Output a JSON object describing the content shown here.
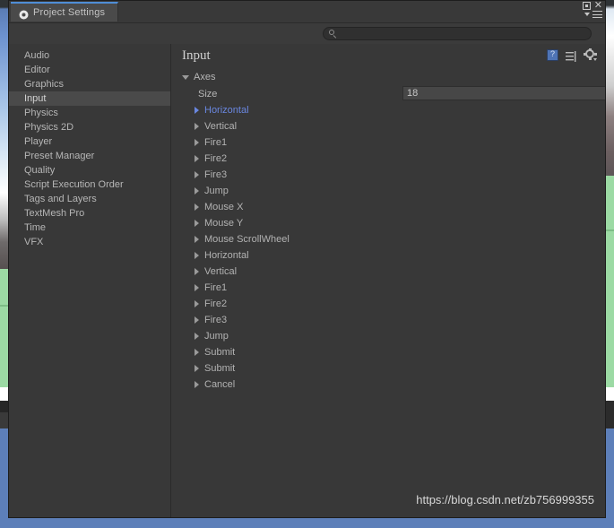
{
  "window": {
    "tab_label": "Project Settings",
    "tab_icon": "gear-icon",
    "controls": {
      "maximize": "maximize-icon",
      "close": "close-icon",
      "menu": "hamburger-menu-icon"
    }
  },
  "search": {
    "value": "",
    "placeholder": "",
    "icon": "search-icon"
  },
  "sidebar": {
    "items": [
      {
        "label": "Audio",
        "selected": false
      },
      {
        "label": "Editor",
        "selected": false
      },
      {
        "label": "Graphics",
        "selected": false
      },
      {
        "label": "Input",
        "selected": true
      },
      {
        "label": "Physics",
        "selected": false
      },
      {
        "label": "Physics 2D",
        "selected": false
      },
      {
        "label": "Player",
        "selected": false
      },
      {
        "label": "Preset Manager",
        "selected": false
      },
      {
        "label": "Quality",
        "selected": false
      },
      {
        "label": "Script Execution Order",
        "selected": false
      },
      {
        "label": "Tags and Layers",
        "selected": false
      },
      {
        "label": "TextMesh Pro",
        "selected": false
      },
      {
        "label": "Time",
        "selected": false
      },
      {
        "label": "VFX",
        "selected": false
      }
    ]
  },
  "main": {
    "title": "Input",
    "toolbar": {
      "help_icon": "help-book-icon",
      "preset_icon": "preset-icon",
      "settings_icon": "gear-dropdown-icon"
    },
    "axes": {
      "group_label": "Axes",
      "size_label": "Size",
      "size_value": "18",
      "items": [
        {
          "label": "Horizontal",
          "selected": true
        },
        {
          "label": "Vertical",
          "selected": false
        },
        {
          "label": "Fire1",
          "selected": false
        },
        {
          "label": "Fire2",
          "selected": false
        },
        {
          "label": "Fire3",
          "selected": false
        },
        {
          "label": "Jump",
          "selected": false
        },
        {
          "label": "Mouse X",
          "selected": false
        },
        {
          "label": "Mouse Y",
          "selected": false
        },
        {
          "label": "Mouse ScrollWheel",
          "selected": false
        },
        {
          "label": "Horizontal",
          "selected": false
        },
        {
          "label": "Vertical",
          "selected": false
        },
        {
          "label": "Fire1",
          "selected": false
        },
        {
          "label": "Fire2",
          "selected": false
        },
        {
          "label": "Fire3",
          "selected": false
        },
        {
          "label": "Jump",
          "selected": false
        },
        {
          "label": "Submit",
          "selected": false
        },
        {
          "label": "Submit",
          "selected": false
        },
        {
          "label": "Cancel",
          "selected": false
        }
      ]
    }
  },
  "watermark": {
    "text": "https://blog.csdn.net/zb756999355"
  },
  "colors": {
    "window_bg": "#383838",
    "panel_bg": "#3b3b3b",
    "selected_row": "#4a4a4a",
    "accent_blue": "#6a87e0",
    "tab_accent": "#4f8ed6",
    "text": "#b6b6b6",
    "desktop": "#5d7fb9"
  }
}
